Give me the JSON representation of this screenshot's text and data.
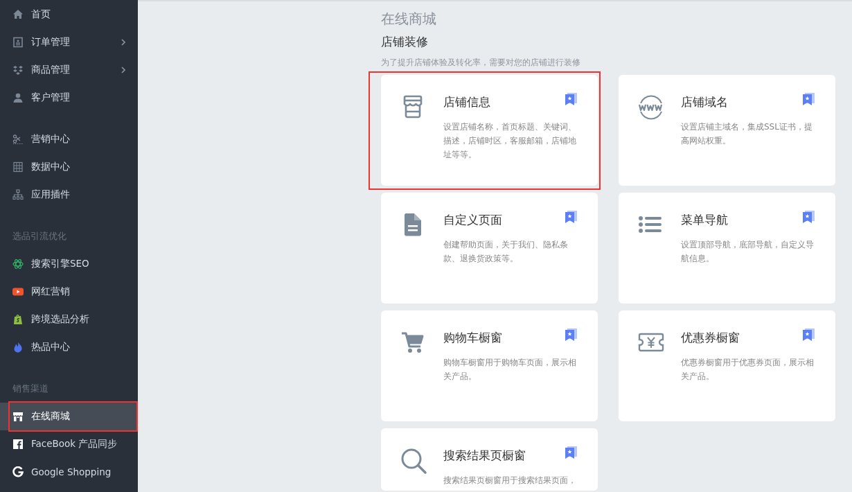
{
  "sidebar": {
    "groups": [
      {
        "items": [
          {
            "label": "首页",
            "has_submenu": false,
            "selected": false,
            "highlighted": false
          },
          {
            "label": "订单管理",
            "has_submenu": true,
            "selected": false,
            "highlighted": false
          },
          {
            "label": "商品管理",
            "has_submenu": true,
            "selected": false,
            "highlighted": false
          },
          {
            "label": "客户管理",
            "has_submenu": false,
            "selected": false,
            "highlighted": false
          }
        ]
      },
      {
        "items": [
          {
            "label": "营销中心",
            "has_submenu": false,
            "selected": false,
            "highlighted": false
          },
          {
            "label": "数据中心",
            "has_submenu": false,
            "selected": false,
            "highlighted": false
          },
          {
            "label": "应用插件",
            "has_submenu": false,
            "selected": false,
            "highlighted": false
          }
        ]
      },
      {
        "heading": "选品引流优化",
        "items": [
          {
            "label": "搜索引擎SEO",
            "has_submenu": false,
            "selected": false,
            "highlighted": false
          },
          {
            "label": "网红营销",
            "has_submenu": false,
            "selected": false,
            "highlighted": false
          },
          {
            "label": "跨境选品分析",
            "has_submenu": false,
            "selected": false,
            "highlighted": false
          },
          {
            "label": "热品中心",
            "has_submenu": false,
            "selected": false,
            "highlighted": false
          }
        ]
      },
      {
        "heading": "销售渠道",
        "items": [
          {
            "label": "在线商城",
            "has_submenu": false,
            "selected": true,
            "highlighted": true
          },
          {
            "label": "FaceBook 产品同步",
            "has_submenu": false,
            "selected": false,
            "highlighted": false
          },
          {
            "label": "Google Shopping",
            "has_submenu": false,
            "selected": false,
            "highlighted": false
          }
        ]
      }
    ]
  },
  "page": {
    "title": "在线商城",
    "subtitle": "店铺装修",
    "description": "为了提升店铺体验及转化率，需要对您的店铺进行装修",
    "cards": [
      {
        "title": "店铺信息",
        "description": "设置店铺名称，首页标题、关键词、描述，店铺时区，客服邮箱，店铺地址等等。",
        "highlighted": true
      },
      {
        "title": "店铺域名",
        "description": "设置店铺主域名，集成SSL证书，提高网站权重。",
        "highlighted": false
      },
      {
        "title": "自定义页面",
        "description": "创建帮助页面，关于我们、隐私条款、退换货政策等。",
        "highlighted": false
      },
      {
        "title": "菜单导航",
        "description": "设置顶部导航，底部导航，自定义导航信息。",
        "highlighted": false
      },
      {
        "title": "购物车橱窗",
        "description": "购物车橱窗用于购物车页面，展示相关产品。",
        "highlighted": false
      },
      {
        "title": "优惠券橱窗",
        "description": "优惠券橱窗用于优惠券页面，展示相关产品。",
        "highlighted": false
      },
      {
        "title": "搜索结果页橱窗",
        "description": "搜索结果页橱窗用于搜索结果页面，",
        "highlighted": false
      }
    ]
  }
}
